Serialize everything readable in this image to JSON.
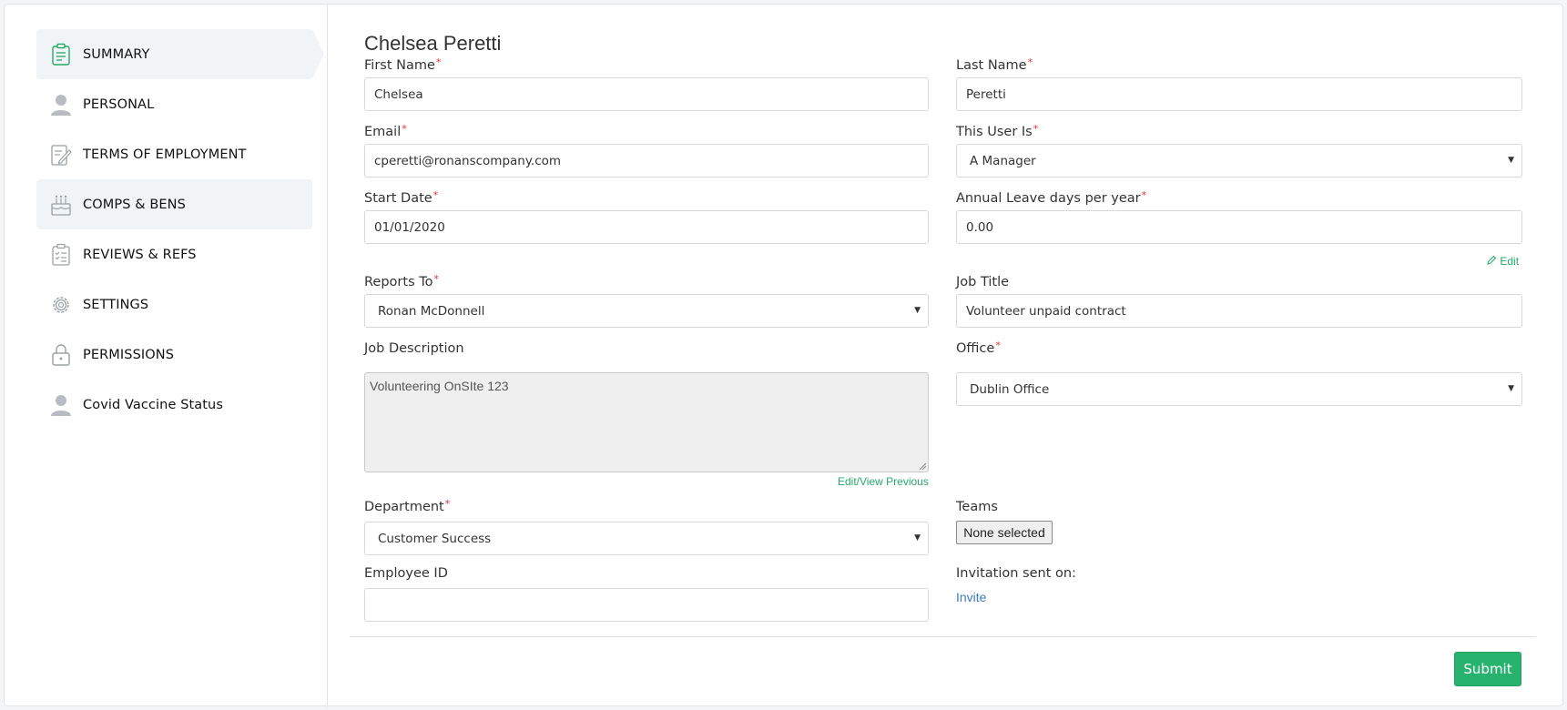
{
  "sidebar": {
    "items": [
      {
        "label": "SUMMARY",
        "icon": "summary-clipboard-icon"
      },
      {
        "label": "PERSONAL",
        "icon": "person-icon"
      },
      {
        "label": "TERMS OF EMPLOYMENT",
        "icon": "document-edit-icon"
      },
      {
        "label": "COMPS & BENS",
        "icon": "cake-icon"
      },
      {
        "label": "REVIEWS & REFS",
        "icon": "checklist-icon"
      },
      {
        "label": "SETTINGS",
        "icon": "gear-icon"
      },
      {
        "label": "PERMISSIONS",
        "icon": "lock-icon"
      },
      {
        "label": "Covid Vaccine Status",
        "icon": "person-icon"
      }
    ]
  },
  "form": {
    "title": "Chelsea Peretti",
    "first_name": {
      "label": "First Name",
      "value": "Chelsea"
    },
    "last_name": {
      "label": "Last Name",
      "value": "Peretti"
    },
    "email": {
      "label": "Email",
      "value": "cperetti@ronanscompany.com"
    },
    "user_type": {
      "label": "This User Is",
      "value": "A Manager"
    },
    "start_date": {
      "label": "Start Date",
      "value": "01/01/2020"
    },
    "annual_leave": {
      "label": "Annual Leave days per year",
      "value": "0.00",
      "edit_label": "Edit"
    },
    "reports_to": {
      "label": "Reports To",
      "value": "Ronan McDonnell"
    },
    "job_title": {
      "label": "Job Title",
      "value": "Volunteer unpaid contract"
    },
    "job_description": {
      "label": "Job Description",
      "value": "Volunteering OnSIte 123",
      "history_label": "Edit/View Previous"
    },
    "office": {
      "label": "Office",
      "value": "Dublin Office"
    },
    "department": {
      "label": "Department",
      "value": "Customer Success"
    },
    "teams": {
      "label": "Teams",
      "value": "None selected"
    },
    "employee_id": {
      "label": "Employee ID",
      "value": ""
    },
    "invitation": {
      "label": "Invitation sent on:",
      "link": "Invite"
    },
    "submit_label": "Submit",
    "required_mark": "*"
  },
  "colors": {
    "accent_green": "#27b36e",
    "link_blue": "#3b7dc4",
    "required_red": "#e0332f",
    "active_nav_bg": "#f1f4f6"
  }
}
